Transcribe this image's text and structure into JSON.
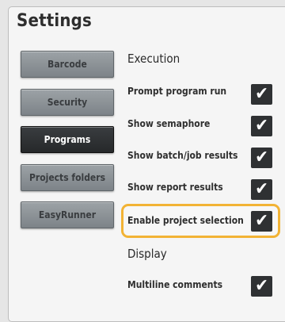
{
  "title": "Settings",
  "nav": [
    {
      "label": "Barcode"
    },
    {
      "label": "Security"
    },
    {
      "label": "Programs"
    },
    {
      "label": "Projects folders"
    },
    {
      "label": "EasyRunner"
    }
  ],
  "active_nav": "Programs",
  "sections": {
    "execution": "Execution",
    "display": "Display"
  },
  "options": [
    {
      "label": "Prompt program run",
      "checked": true
    },
    {
      "label": "Show semaphore",
      "checked": true
    },
    {
      "label": "Show batch/job results",
      "checked": true
    },
    {
      "label": "Show report results",
      "checked": true
    },
    {
      "label": "Enable project selection",
      "checked": true,
      "highlighted": true
    },
    {
      "label": "Multiline comments",
      "checked": true
    }
  ],
  "icons": {
    "checkbox_mark": "checkmark-icon"
  },
  "colors": {
    "highlight": "#f2b335",
    "active_nav": "#2e3032",
    "checkbox": "#2f3133"
  }
}
